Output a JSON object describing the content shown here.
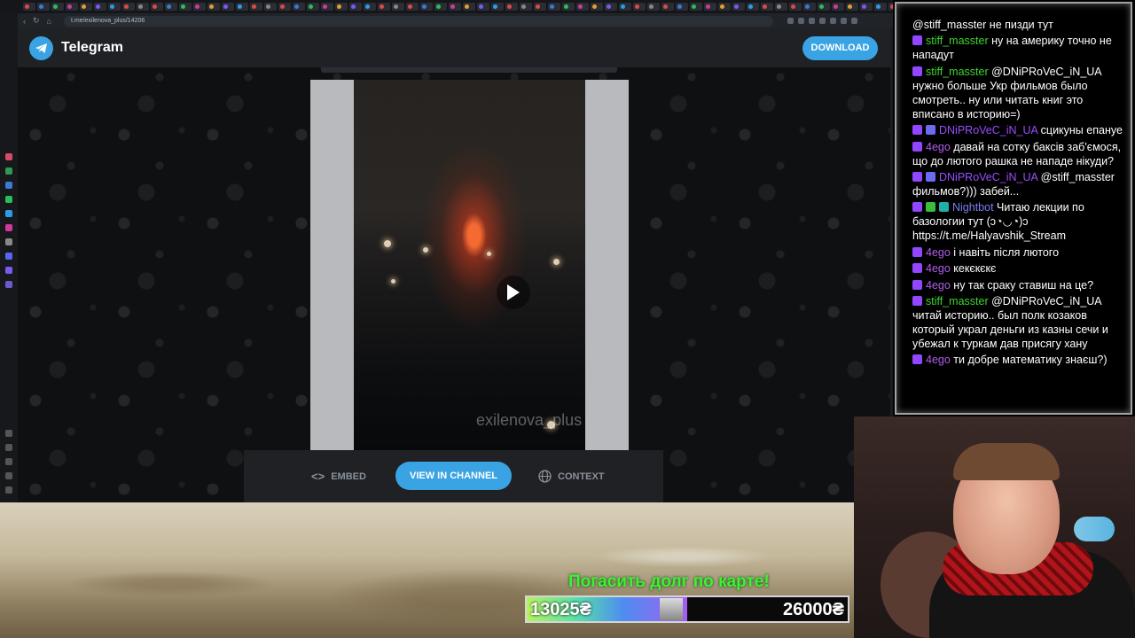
{
  "browser": {
    "url": "t.me/exilenova_plus/14206"
  },
  "telegram": {
    "brand": "Telegram",
    "download_label": "DOWNLOAD",
    "watermark": "exilenova_plus",
    "embed_label": "EMBED",
    "view_channel_label": "VIEW IN CHANNEL",
    "context_label": "CONTEXT",
    "accent": "#3aa3e3"
  },
  "chat": {
    "messages": [
      {
        "user": "",
        "user_color": "#ffffff",
        "text": "@stiff_masster не пизди тут",
        "badges": []
      },
      {
        "user": "stiff_masster",
        "user_color": "#3fd32f",
        "text": "ну на америку точно не нападут",
        "badges": [
          "twitch-icon"
        ]
      },
      {
        "user": "stiff_masster",
        "user_color": "#3fd32f",
        "text": "@DNiPRoVeC_iN_UA нужно больше Укр фильмов было смотреть.. ну или читать книг это вписано в историю=)",
        "badges": [
          "twitch-icon"
        ]
      },
      {
        "user": "DNiPRoVeC_iN_UA",
        "user_color": "#9b4dff",
        "text": "сцикуны епануе",
        "badges": [
          "twitch-icon",
          "gamepad-icon"
        ]
      },
      {
        "user": "4ego",
        "user_color": "#b05de5",
        "text": "давай на сотку баксів заб'ємося, що до лютого рашка не нападе нікуди?",
        "badges": [
          "twitch-icon"
        ]
      },
      {
        "user": "DNiPRoVeC_iN_UA",
        "user_color": "#9b4dff",
        "text": "@stiff_masster фильмов?))) забей...",
        "badges": [
          "twitch-icon",
          "gamepad-icon"
        ]
      },
      {
        "user": "Nightbot",
        "user_color": "#7c7cf5",
        "text": "Читаю лекции по базологии тут (ↄ◔◡◔)ↄ https://t.me/Halyavshik_Stream",
        "badges": [
          "twitch-icon",
          "check-icon",
          "bot-icon"
        ]
      },
      {
        "user": "4ego",
        "user_color": "#b05de5",
        "text": "і навіть після лютого",
        "badges": [
          "twitch-icon"
        ]
      },
      {
        "user": "4ego",
        "user_color": "#b05de5",
        "text": "кекєкєкє",
        "badges": [
          "twitch-icon"
        ]
      },
      {
        "user": "4ego",
        "user_color": "#b05de5",
        "text": "ну так сраку ставиш на це?",
        "badges": [
          "twitch-icon"
        ]
      },
      {
        "user": "stiff_masster",
        "user_color": "#3fd32f",
        "text": "@DNiPRoVeC_iN_UA читай историю.. был полк козаков который украл деньги из казны сечи и убежал к туркам дав присягу хану",
        "badges": [
          "twitch-icon"
        ]
      },
      {
        "user": "4ego",
        "user_color": "#b05de5",
        "text": "ти добре математику знаєш?)",
        "badges": [
          "twitch-icon"
        ]
      }
    ]
  },
  "goal": {
    "title": "Погасить долг по карте!",
    "current": "13025₴",
    "target": "26000₴",
    "progress": 0.501
  }
}
